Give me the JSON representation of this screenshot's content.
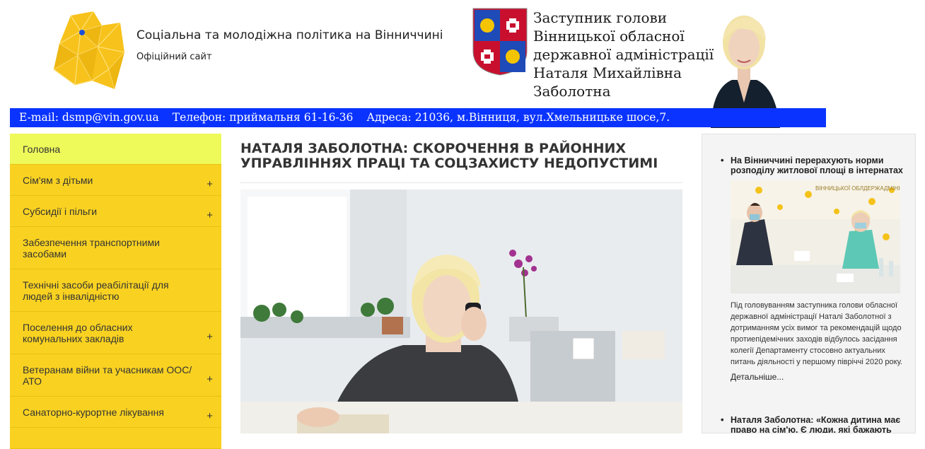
{
  "header": {
    "site_title": "Соціальна та молодіжна політика на Вінниччині",
    "site_subtitle": "Офіційний сайт",
    "deputy_lines": [
      "Заступник голови",
      "Вінницької обласної",
      "державної адміністрації",
      "Наталя Михайлівна",
      "Заболотна"
    ],
    "contact": {
      "email": "E-mail: dsmp@vin.gov.ua",
      "phone": "Телефон: приймальня 61-16-36",
      "address": "Адреса: 21036, м.Вінниця, вул.Хмельницьке шосе,7."
    },
    "colors": {
      "contact_bar": "#0a33ff",
      "logo": "#f7c21b"
    }
  },
  "sidebar": {
    "items": [
      {
        "label": "Головна",
        "active": true,
        "expandable": false
      },
      {
        "label": "Сім'ям з дітьми",
        "active": false,
        "expandable": true
      },
      {
        "label": "Субсидії і пільги",
        "active": false,
        "expandable": true
      },
      {
        "label": "Забезпечення транспортними засобами",
        "active": false,
        "expandable": false
      },
      {
        "label": "Технічні засоби реабілітації для людей з інвалідністю",
        "active": false,
        "expandable": false
      },
      {
        "label": "Поселення до обласних комунальних закладів",
        "active": false,
        "expandable": true
      },
      {
        "label": "Ветеранам війни та учасникам ООС/АТО",
        "active": false,
        "expandable": true
      },
      {
        "label": "Санаторно-курортне лікування",
        "active": false,
        "expandable": true
      }
    ],
    "plus_symbol": "+",
    "colors": {
      "item": "#f9d221",
      "active": "#eef95a"
    }
  },
  "article": {
    "title": "НАТАЛЯ ЗАБОЛОТНА: СКОРОЧЕННЯ В РАЙОННИХ УПРАВЛІННЯХ ПРАЦІ ТА СОЦЗАХИСТУ НЕДОПУСТИМІ"
  },
  "right_news": [
    {
      "title": "На Вінниччині перерахують норми розподілу житлової площі в інтернатах",
      "image_banner_text": "ВІННИЦЬКОЇ ОБЛДЕРЖАДМІНІСТРАЦІЇ",
      "text": "Під головуванням заступника голови обласної державної адміністрації Наталі Заболотної з дотриманням усіх вимог та рекомендацій щодо протиепідемічних заходів відбулось засідання колегії Департаменту стосовно актуальних питань діяльності у першому півріччі 2020 року.",
      "more": "Детальніше..."
    },
    {
      "title": "Наталя Заболотна: «Кожна дитина має право на сім'ю. Є люди, які бажають"
    }
  ]
}
